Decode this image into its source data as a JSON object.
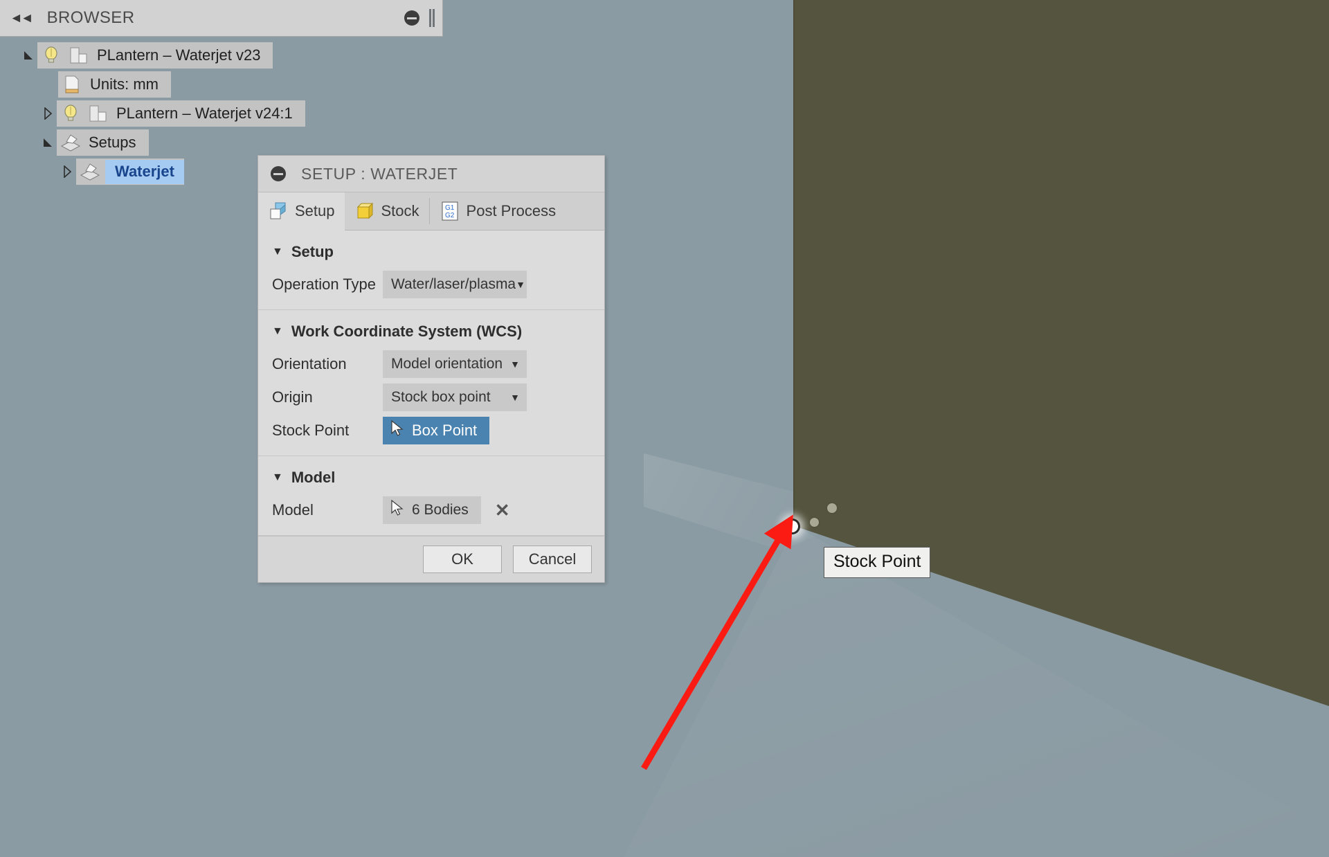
{
  "browser": {
    "title": "BROWSER",
    "collapse_icon": "collapse-left-icon",
    "minimize_icon": "minimize-icon",
    "tree": [
      {
        "label": "PLantern – Waterjet v23",
        "arrow": "▰",
        "icons": [
          "lightbulb-icon",
          "component-icon"
        ],
        "expanded": true,
        "selected": false,
        "indent": 0
      },
      {
        "label": "Units: mm",
        "arrow": "",
        "icons": [
          "document-ruler-icon"
        ],
        "expanded": false,
        "selected": false,
        "indent": 1
      },
      {
        "label": "PLantern – Waterjet v24:1",
        "arrow": "▷",
        "icons": [
          "lightbulb-icon",
          "component-icon"
        ],
        "expanded": false,
        "selected": false,
        "indent": 1
      },
      {
        "label": "Setups",
        "arrow": "▰",
        "icons": [
          "setup-folder-icon"
        ],
        "expanded": true,
        "selected": false,
        "indent": 1
      },
      {
        "label": "Waterjet",
        "arrow": "▷",
        "icons": [
          "setup-folder-icon"
        ],
        "expanded": false,
        "selected": true,
        "indent": 2
      }
    ]
  },
  "dialog": {
    "title": "SETUP : WATERJET",
    "minimize_icon": "minimize-icon",
    "tabs": [
      {
        "label": "Setup",
        "icon": "setup-cube-icon",
        "active": true
      },
      {
        "label": "Stock",
        "icon": "stock-box-icon",
        "active": false
      },
      {
        "label": "Post Process",
        "icon": "gcode-icon",
        "active": false
      }
    ],
    "sections": [
      {
        "title": "Setup",
        "caret": "▼",
        "fields": [
          {
            "label": "Operation Type",
            "type": "combo",
            "value": "Water/laser/plasma",
            "caret": "▼"
          }
        ]
      },
      {
        "title": "Work Coordinate System (WCS)",
        "caret": "▼",
        "fields": [
          {
            "label": "Orientation",
            "type": "combo",
            "value": "Model orientation",
            "caret": "▼"
          },
          {
            "label": "Origin",
            "type": "combo",
            "value": "Stock box point",
            "caret": "▼"
          },
          {
            "label": "Stock Point",
            "type": "select-active",
            "value": "Box Point",
            "icon": "cursor-arrow-icon"
          }
        ]
      },
      {
        "title": "Model",
        "caret": "▼",
        "fields": [
          {
            "label": "Model",
            "type": "select",
            "value": "6 Bodies",
            "icon": "cursor-arrow-icon",
            "clear_icon": "close-x-icon",
            "clear_label": "✕"
          }
        ]
      }
    ],
    "footer": {
      "ok_label": "OK",
      "cancel_label": "Cancel"
    }
  },
  "viewport": {
    "tooltip_label": "Stock Point",
    "stock_point_marker": "stock-point-marker-icon",
    "annotation_arrow": "red-arrow-annotation"
  },
  "colors": {
    "background": "#8b9ba3",
    "solid_body": "#54543f",
    "accent_blue": "#4a82b0",
    "selection_blue": "#a6cbf2",
    "selection_text": "#18458c",
    "annotation_red": "#fb1b12",
    "panel_grey": "#dcdcdc",
    "chip_grey": "#c3c3c3"
  }
}
